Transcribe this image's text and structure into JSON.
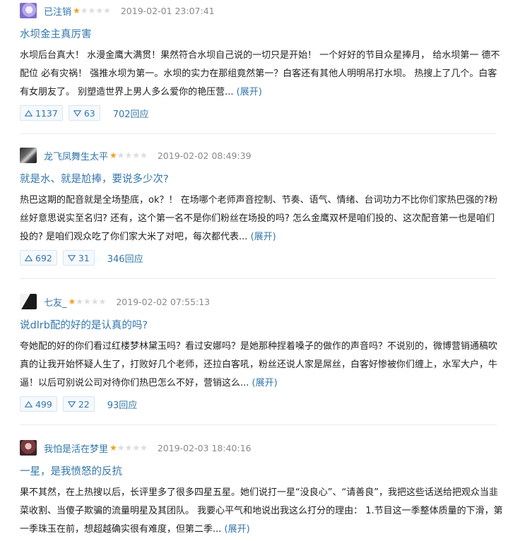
{
  "reviews": [
    {
      "author": "已注销",
      "stars_filled": 1,
      "stars_total": 5,
      "time": "2019-02-01 23:07:41",
      "title": "水坝金主真厉害",
      "content": "水坝后台真大！ 水漫金鹰大满贯！果然符合水坝自己说的一切只是开始！ 一个好好的节目众星捧月， 给水坝第一 德不配位 必有灾祸！ 强推水坝为第一。水坝的实力在那组竟然第一？白客还有其他人明明吊打水坝。 热搜上了几个。白客有女朋友了。 别塑造世界上男人多么爱你的艳压营... ",
      "expand": "(展开)",
      "up": "1137",
      "down": "63",
      "replies": "702回应"
    },
    {
      "author": "龙飞凤舞生太平",
      "stars_filled": 1,
      "stars_total": 5,
      "time": "2019-02-02 08:49:39",
      "title": "就是水、就是尬捧，要说多少次?",
      "content": "热巴这期的配音就是全场垫底，ok？！ 在场哪个老师声音控制、节奏、语气、情绪、台词功力不比你们家热巴强的?粉丝好意思说实至名归? 还有，这个第一名不是你们粉丝在场投的吗? 怎么金鹰双杯是咱们投的、这次配音第一也是咱们投的? 是咱们观众吃了你们家大米了对吧，每次都代表... ",
      "expand": "(展开)",
      "up": "692",
      "down": "31",
      "replies": "346回应"
    },
    {
      "author": "七友_",
      "stars_filled": 1,
      "stars_total": 5,
      "time": "2019-02-02 07:55:13",
      "title": "说dlrb配的好的是认真的吗?",
      "content": "夸她配的好的你们看过红楼梦林黛玉吗？看过安娜吗？是她那种捏着嗓子的做作的声音吗？不说别的，微博营销通稿吹真的让我开始怀疑人生了，打败好几个老师，还拉白客吼，粉丝还说人家是屌丝，白客好惨被你们缠上，水军大户，牛逼！以后可别说公司对待你们热巴怎么不好，营销这么... ",
      "expand": "(展开)",
      "up": "499",
      "down": "22",
      "replies": "93回应"
    },
    {
      "author": "我怕是活在梦里",
      "stars_filled": 1,
      "stars_total": 5,
      "time": "2019-02-03 18:40:16",
      "title": "一星，是我愤怒的反抗",
      "content": "果不其然，在上热搜以后，长评里多了很多四星五星。她们说打一星“没良心”、“请善良”，我把这些话送给把观众当韭菜收割、当傻子欺骗的流量明星及其团队。 我要心平气和地说出我这么打分的理由： 1.节目这一季整体质量的下滑，第一季珠玉在前，想超越确实很有难度，但第二季... ",
      "expand": "(展开)"
    }
  ],
  "icons": {
    "up": "triangle-up-icon",
    "down": "triangle-down-icon",
    "star": "star-icon"
  },
  "colors": {
    "link": "#3377aa",
    "star": "#f0a21e",
    "star_empty": "#dcdcdc",
    "time": "#8a8a8a",
    "vote_bg": "#f5f9fd",
    "vote_border": "#d7e5f2"
  }
}
